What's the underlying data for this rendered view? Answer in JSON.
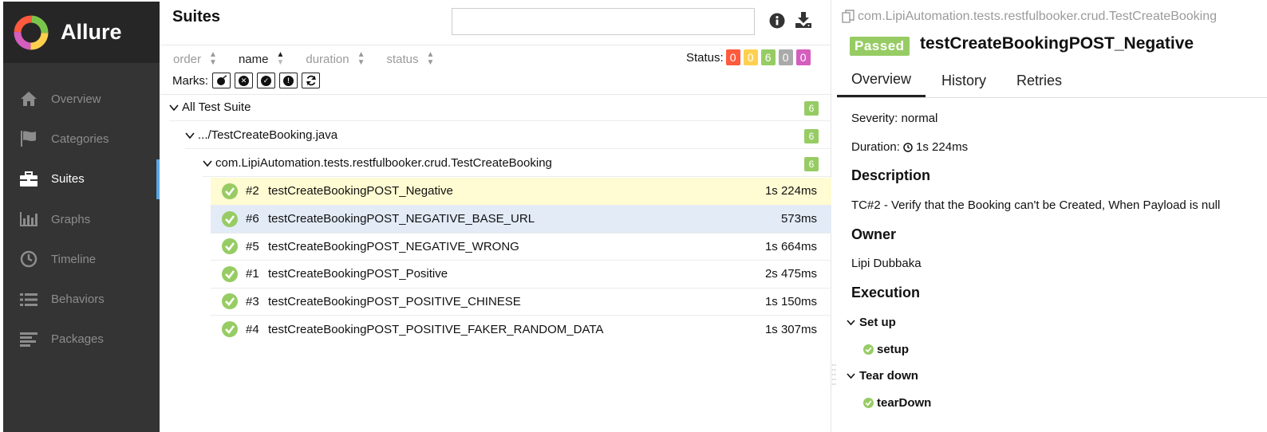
{
  "app": {
    "name": "Allure"
  },
  "sidebar": {
    "items": [
      {
        "label": "Overview",
        "icon": "home-icon"
      },
      {
        "label": "Categories",
        "icon": "flag-icon"
      },
      {
        "label": "Suites",
        "icon": "briefcase-icon",
        "active": true
      },
      {
        "label": "Graphs",
        "icon": "bar-chart-icon"
      },
      {
        "label": "Timeline",
        "icon": "clock-icon"
      },
      {
        "label": "Behaviors",
        "icon": "list-icon"
      },
      {
        "label": "Packages",
        "icon": "align-left-icon"
      }
    ]
  },
  "tree": {
    "title": "Suites",
    "search": {
      "value": "",
      "placeholder": ""
    },
    "sort": {
      "order": "order",
      "name": "name",
      "duration": "duration",
      "status": "status",
      "active": "name"
    },
    "status_label": "Status:",
    "status_counts": [
      {
        "value": "0",
        "color": "#fd5a3e"
      },
      {
        "value": "0",
        "color": "#ffd050"
      },
      {
        "value": "6",
        "color": "#97cc64"
      },
      {
        "value": "0",
        "color": "#aaaaaa"
      },
      {
        "value": "0",
        "color": "#d35ebe"
      }
    ],
    "marks_label": "Marks:",
    "marks": [
      "bomb-icon",
      "times-circle-icon",
      "check-circle-icon",
      "exclamation-circle-icon",
      "refresh-icon"
    ],
    "groups": [
      {
        "label": "All Test Suite",
        "count": "6"
      },
      {
        "label": ".../TestCreateBooking.java",
        "count": "6"
      },
      {
        "label": "com.LipiAutomation.tests.restfulbooker.crud.TestCreateBooking",
        "count": "6"
      }
    ],
    "rows": [
      {
        "num": "#2",
        "name": "testCreateBookingPOST_Negative",
        "duration": "1s 224ms"
      },
      {
        "num": "#6",
        "name": "testCreateBookingPOST_NEGATIVE_BASE_URL",
        "duration": "573ms"
      },
      {
        "num": "#5",
        "name": "testCreateBookingPOST_NEGATIVE_WRONG",
        "duration": "1s 664ms"
      },
      {
        "num": "#1",
        "name": "testCreateBookingPOST_Positive",
        "duration": "2s 475ms"
      },
      {
        "num": "#3",
        "name": "testCreateBookingPOST_POSITIVE_CHINESE",
        "duration": "1s 150ms"
      },
      {
        "num": "#4",
        "name": "testCreateBookingPOST_POSITIVE_FAKER_RANDOM_DATA",
        "duration": "1s 307ms"
      }
    ],
    "colors": {
      "passed": "#97cc64",
      "selected_row": "#fffbd2",
      "hover_row": "#e3ebf7"
    }
  },
  "detail": {
    "path": "com.LipiAutomation.tests.restfulbooker.crud.TestCreateBooking",
    "status": "Passed",
    "title": "testCreateBookingPOST_Negative",
    "tabs": [
      "Overview",
      "History",
      "Retries"
    ],
    "severity": "Severity: normal",
    "duration_label": "Duration:",
    "duration_value": "1s 224ms",
    "description_heading": "Description",
    "description": "TC#2 - Verify that the Booking can't be Created, When Payload is null",
    "owner_heading": "Owner",
    "owner": "Lipi Dubbaka",
    "execution_heading": "Execution",
    "setup_heading": "Set up",
    "setup_step": "setup",
    "teardown_heading": "Tear down",
    "teardown_step": "tearDown"
  }
}
